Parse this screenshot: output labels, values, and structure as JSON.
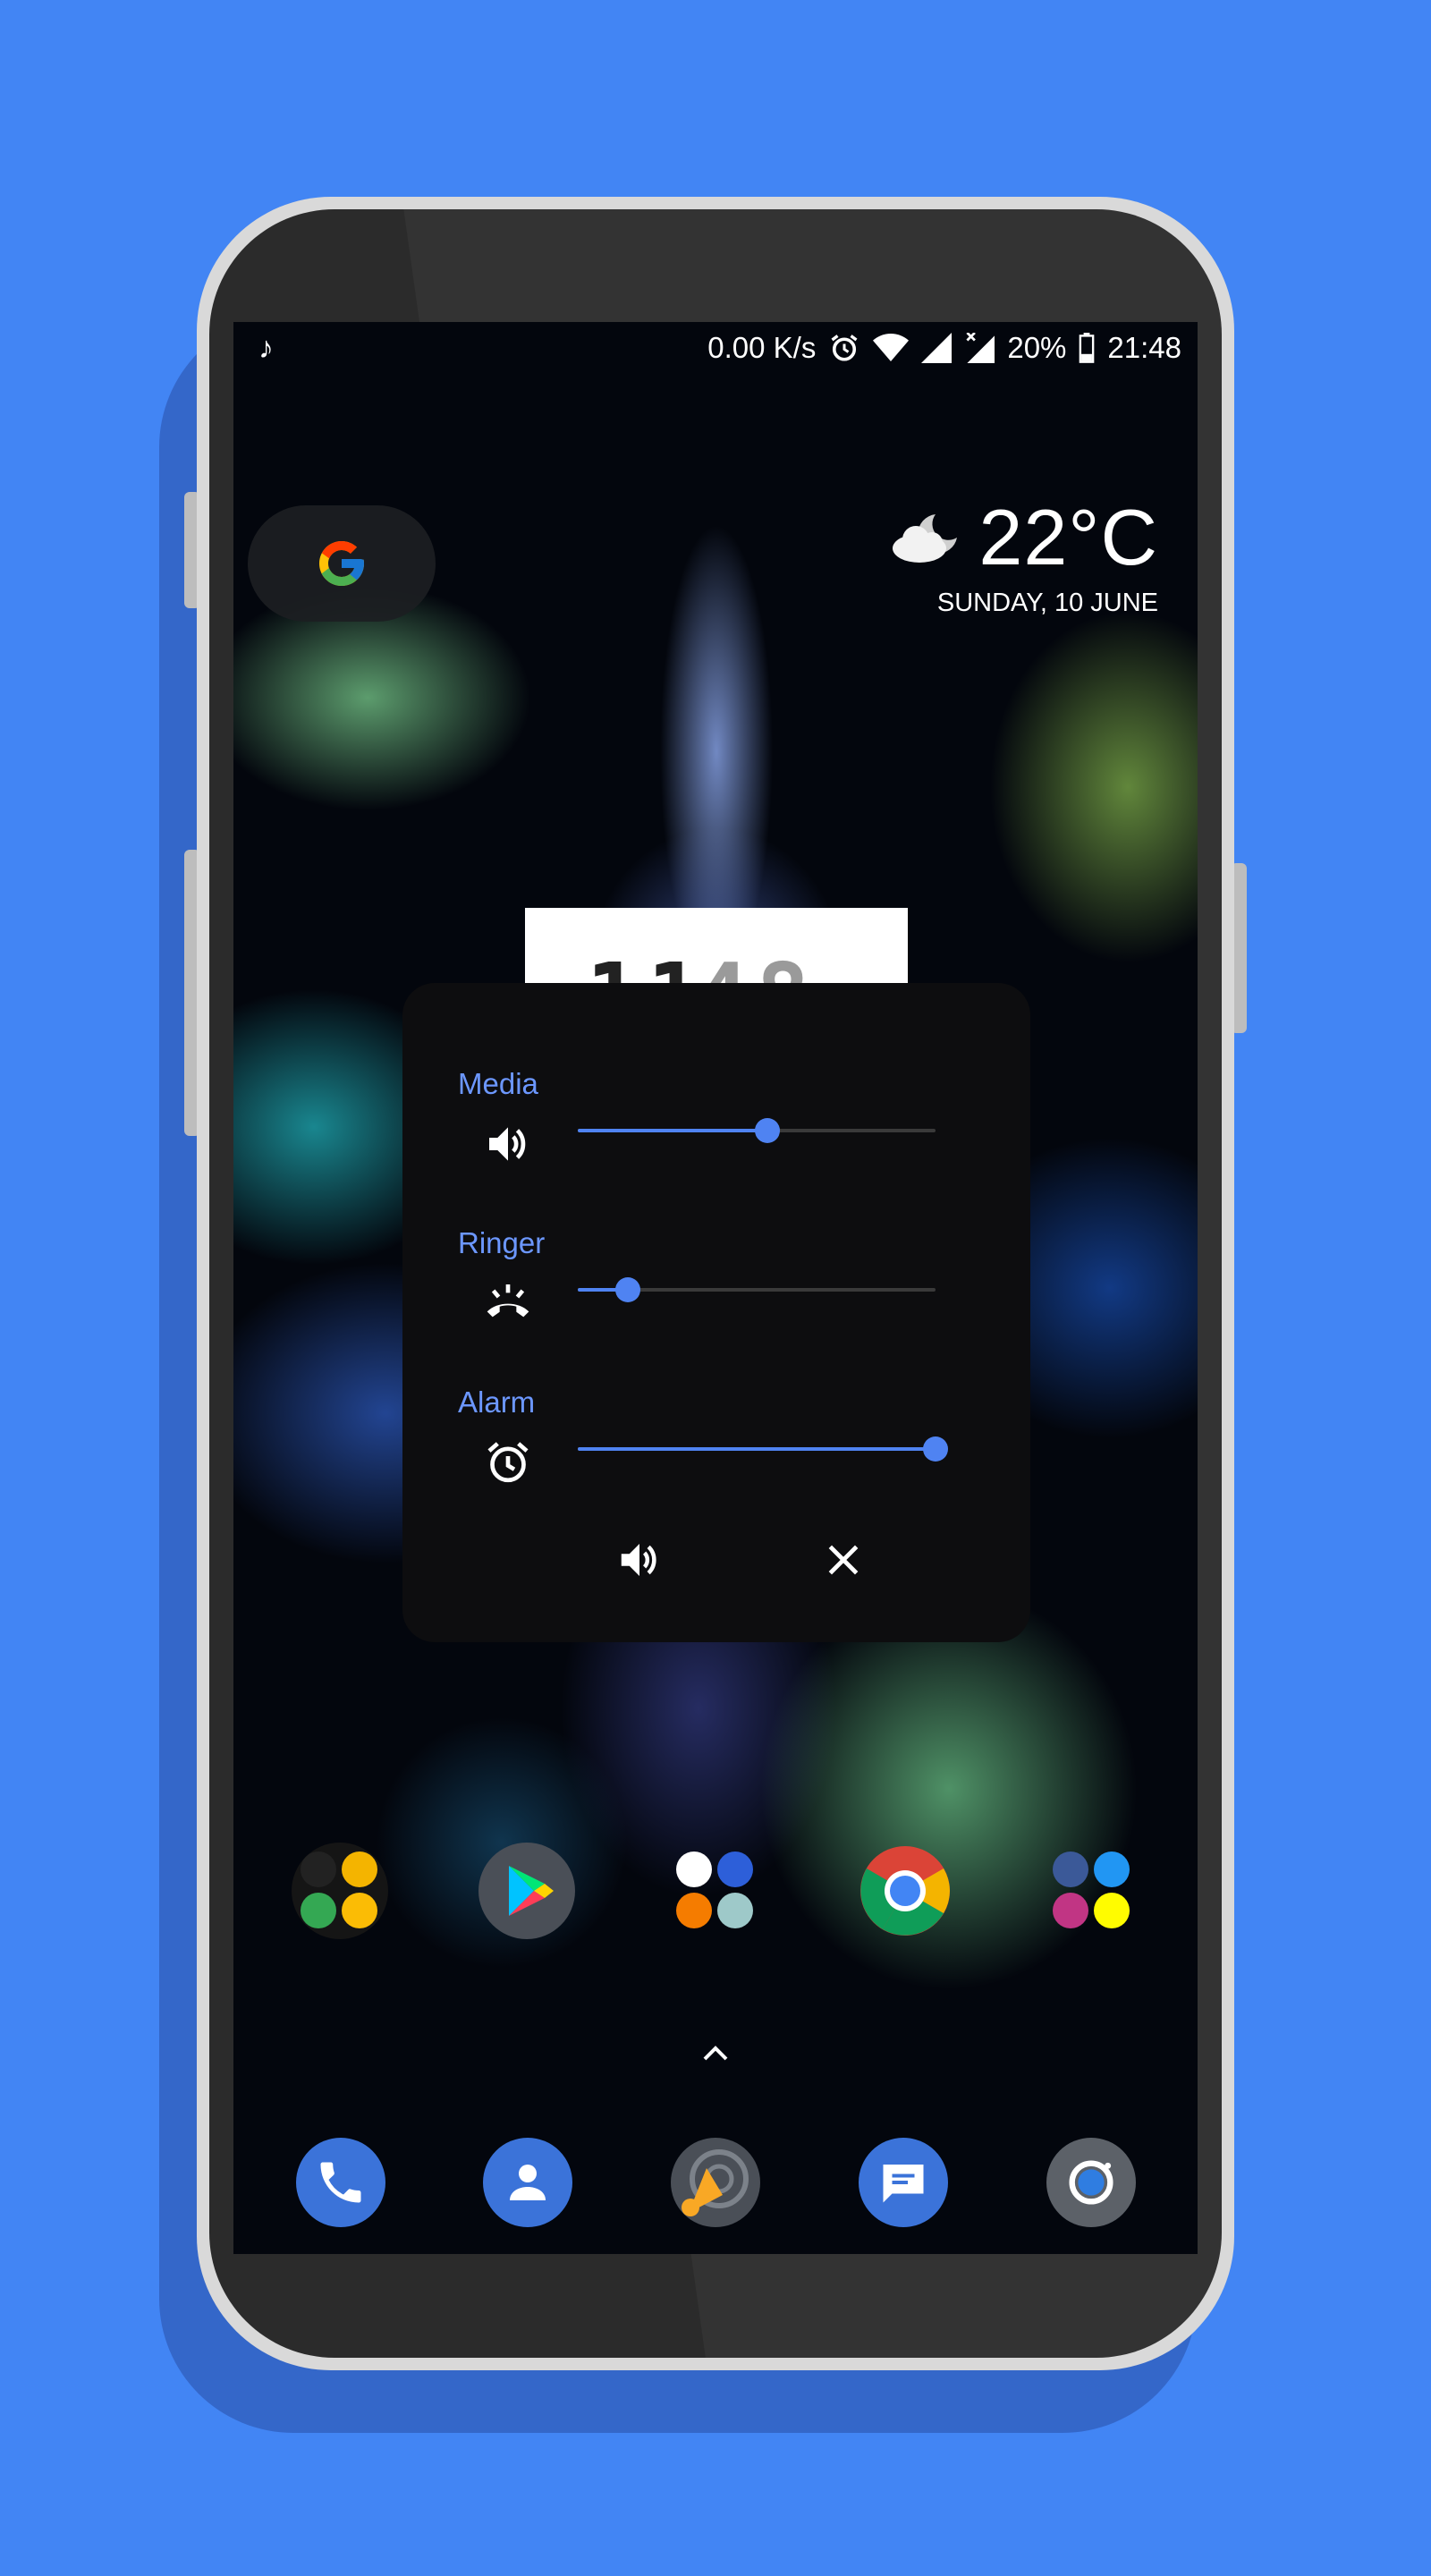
{
  "status_bar": {
    "music_icon": "music-note-icon",
    "net_speed": "0.00 K/s",
    "battery": "20%",
    "time": "21:48"
  },
  "search_widget": {
    "icon": "google-g-icon"
  },
  "weather": {
    "icon": "partly-cloudy-night-icon",
    "temperature": "22°C",
    "date": "SUNDAY, 10 JUNE"
  },
  "clock_widget": {
    "digits_a": "11",
    "digits_b": "48"
  },
  "volume_panel": {
    "sections": [
      {
        "label": "Media",
        "icon": "speaker-icon",
        "level_percent": 53
      },
      {
        "label": "Ringer",
        "icon": "ringer-icon",
        "level_percent": 14
      },
      {
        "label": "Alarm",
        "icon": "alarm-clock-icon",
        "level_percent": 100
      }
    ],
    "mode_button_icon": "speaker-icon",
    "close_button_icon": "close-icon"
  },
  "home_apps": [
    {
      "name": "app-folder-1",
      "icon": "folder-icon"
    },
    {
      "name": "play-store",
      "icon": "play-store-icon"
    },
    {
      "name": "app-folder-2",
      "icon": "folder-icon"
    },
    {
      "name": "chrome",
      "icon": "chrome-icon"
    },
    {
      "name": "social-folder",
      "icon": "folder-icon"
    }
  ],
  "dock": [
    {
      "name": "phone",
      "icon": "phone-icon"
    },
    {
      "name": "contacts",
      "icon": "contacts-icon"
    },
    {
      "name": "music-player",
      "icon": "music-player-icon"
    },
    {
      "name": "messages",
      "icon": "messages-icon"
    },
    {
      "name": "camera",
      "icon": "camera-icon"
    }
  ],
  "colors": {
    "background": "#4285f4",
    "accent": "#4f83f2",
    "label": "#6c97ff",
    "panel": "#0d0d0f"
  }
}
